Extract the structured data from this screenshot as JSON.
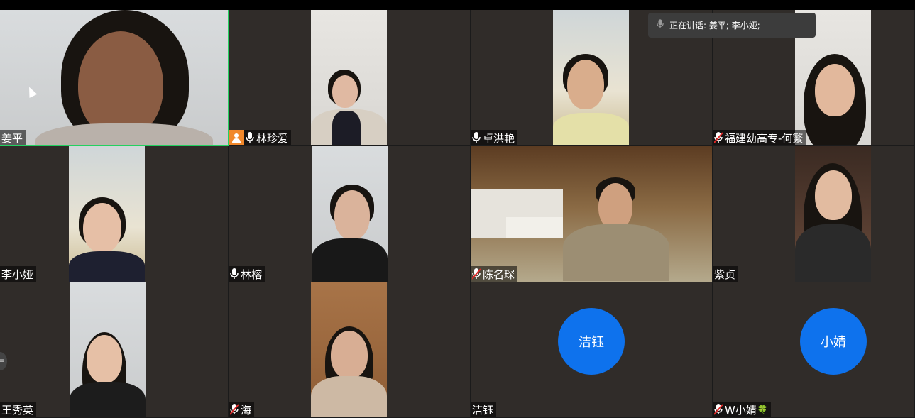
{
  "speaking_indicator": {
    "label": "正在讲话: 姜平; 李小娅;"
  },
  "side_handle": {
    "glyph": "≡"
  },
  "tiles": [
    {
      "name": "姜平",
      "mic": "none",
      "host": false,
      "active": true
    },
    {
      "name": "林珍爱",
      "mic": "on",
      "host": true,
      "active": false
    },
    {
      "name": "卓洪艳",
      "mic": "on",
      "host": false,
      "active": false
    },
    {
      "name": "福建幼高专-何繁",
      "mic": "muted",
      "host": false,
      "active": false
    },
    {
      "name": "李小娅",
      "mic": "none",
      "host": false,
      "active": false
    },
    {
      "name": "林榕",
      "mic": "on",
      "host": false,
      "active": false
    },
    {
      "name": "陈名琛",
      "mic": "muted",
      "host": false,
      "active": false
    },
    {
      "name": "紫贞",
      "mic": "none",
      "host": false,
      "active": false
    },
    {
      "name": "王秀英",
      "mic": "none",
      "host": false,
      "active": false
    },
    {
      "name": "海",
      "mic": "muted",
      "host": false,
      "active": false
    },
    {
      "name": "洁钰",
      "mic": "none",
      "host": false,
      "active": false,
      "avatar": "洁钰"
    },
    {
      "name": "W小婧",
      "mic": "muted",
      "host": false,
      "active": false,
      "avatar": "小婧",
      "emoji": "🍀"
    }
  ],
  "colors": {
    "avatar_blue": "#0e72ed",
    "tile_bg": "#302c29",
    "active_border": "#23d160",
    "host_badge": "#f1882b",
    "muted_red": "#e02828"
  }
}
